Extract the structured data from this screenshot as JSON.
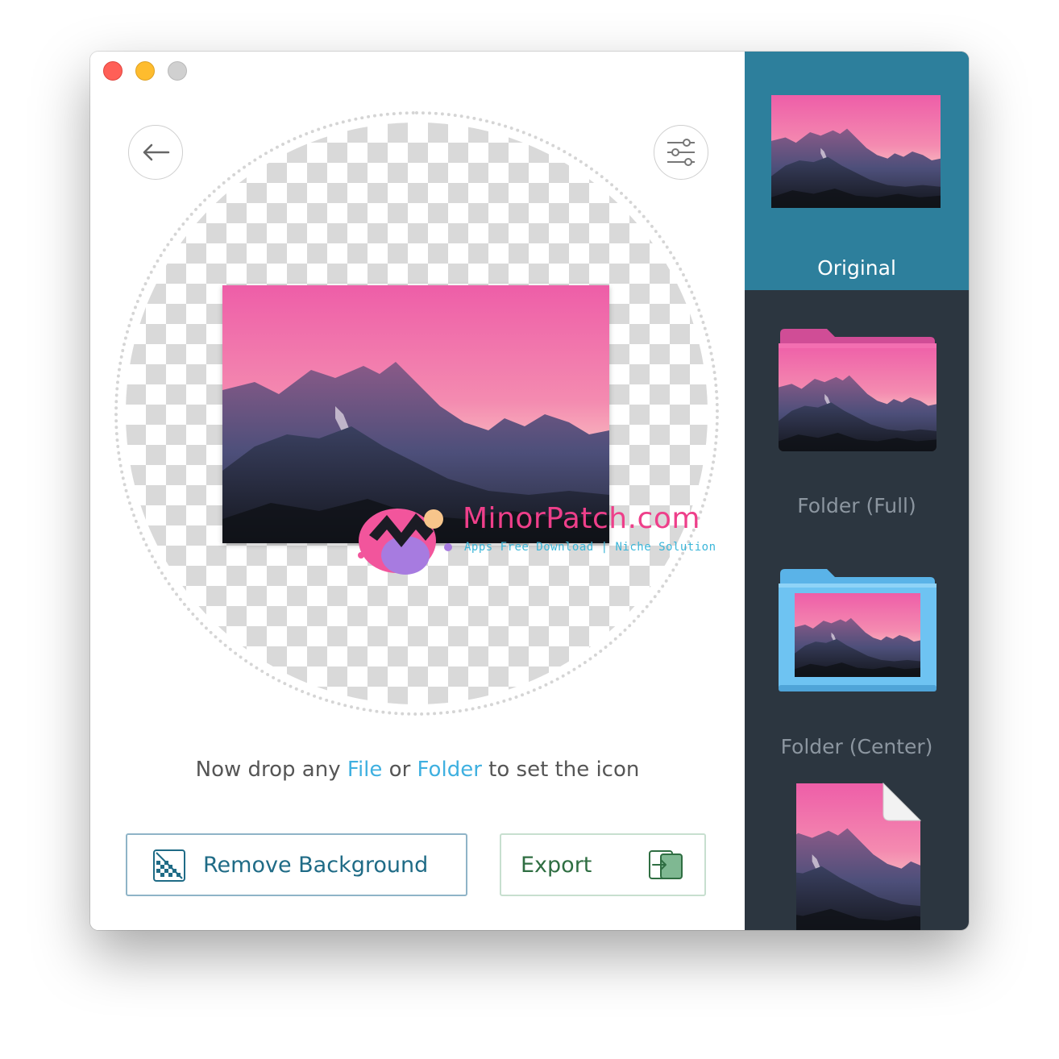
{
  "window": {
    "controls": [
      "close",
      "minimize",
      "zoom"
    ]
  },
  "toolbar": {
    "back_icon": "arrow-left-icon",
    "settings_icon": "sliders-icon"
  },
  "watermark": {
    "title": "MinorPatch.com",
    "subtitle": "Apps Free Download | Niche Solution"
  },
  "drop_hint": {
    "prefix": "Now drop any ",
    "file": "File",
    "middle": " or ",
    "folder": "Folder",
    "suffix": " to set the icon"
  },
  "buttons": {
    "remove_background": "Remove Background",
    "export": "Export"
  },
  "sidebar": {
    "items": [
      {
        "label": "Original",
        "selected": true
      },
      {
        "label": "Folder (Full)",
        "selected": false
      },
      {
        "label": "Folder (Center)",
        "selected": false
      },
      {
        "label": "",
        "selected": false
      }
    ]
  },
  "colors": {
    "accent": "#3fb0e0",
    "sidebar_bg": "#2c3640",
    "sidebar_selected": "#2d7f9c",
    "remove_text": "#1f6b86",
    "export_text": "#2f6e42"
  }
}
